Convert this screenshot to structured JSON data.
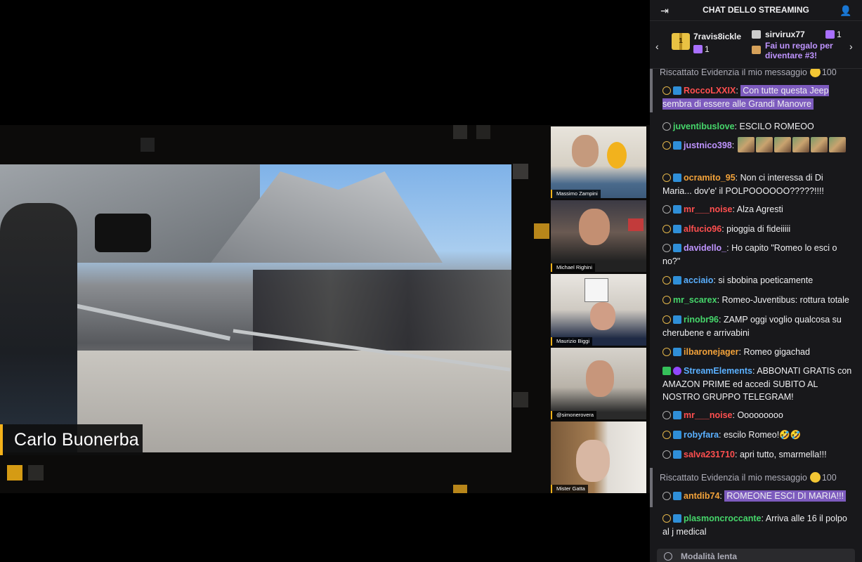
{
  "video": {
    "speaker_name": "Carlo Buonerba",
    "cams": [
      {
        "label": "Massimo Zampini"
      },
      {
        "label": "Michael Righini"
      },
      {
        "label": "Maurizio Biggi"
      },
      {
        "label": "@simonerovera"
      },
      {
        "label": "Mister Gatta"
      }
    ]
  },
  "chat": {
    "header": {
      "title": "CHAT DELLO STREAMING",
      "collapse_icon": "arrow-to-right-icon",
      "users_icon": "users-icon"
    },
    "gifts": {
      "top": {
        "badge": "1",
        "user": "7ravis8ickle",
        "count": "1"
      },
      "second": {
        "user": "sirvirux77",
        "count": "1"
      },
      "cta": "Fai un regalo per diventare #3!"
    },
    "redeem_label": "Riscattato Evidenzia il mio messaggio",
    "redeem_cost": "100",
    "messages": [
      {
        "user": "RoccoLXXIX",
        "color": "#ff4f4f",
        "text": "Con tutte questa Jeep sembra di essere alle Grandi Manovre"
      },
      {
        "user": "juventibuslove",
        "color": "#46d66b",
        "text": "ESCILO ROMEOO"
      },
      {
        "user": "justnico398",
        "color": "#bf94ff",
        "text": ""
      },
      {
        "user": "ocramito_95",
        "color": "#f2a23a",
        "text": "Non ci interessa di Di Maria... dov'e' il POLPOOOOOO?????!!!!"
      },
      {
        "user": "mr___noise",
        "color": "#ff4f4f",
        "text": "Alza Agresti"
      },
      {
        "user": "alfucio96",
        "color": "#ff4f4f",
        "text": "pioggia di fideiiiii"
      },
      {
        "user": "davidello_",
        "color": "#bf94ff",
        "text": "Ho capito \"Romeo lo esci o no?\""
      },
      {
        "user": "acciaio",
        "color": "#5ab0ff",
        "text": "si sbobina poeticamente"
      },
      {
        "user": "mr_scarex",
        "color": "#46d66b",
        "text": "Romeo-Juventibus: rottura totale"
      },
      {
        "user": "rinobr96",
        "color": "#46d66b",
        "text": "ZAMP oggi voglio qualcosa su cherubene e arrivabini"
      },
      {
        "user": "ilbaronejager",
        "color": "#f2a23a",
        "text": "Romeo gigachad"
      },
      {
        "user": "StreamElements",
        "color": "#5ab0ff",
        "text": "ABBONATI GRATIS con AMAZON PRIME ed accedi SUBITO AL NOSTRO GRUPPO TELEGRAM!"
      },
      {
        "user": "mr___noise",
        "color": "#ff4f4f",
        "text": "Ooooooooo"
      },
      {
        "user": "robyfara",
        "color": "#5ab0ff",
        "text": "escilo Romeo!🤣🤣"
      },
      {
        "user": "salva231710",
        "color": "#ff4f4f",
        "text": "apri tutto, smarmella!!!"
      },
      {
        "user": "antdib74",
        "color": "#f2a23a",
        "text": "ROMEONE ESCI DI MARIA!!!"
      },
      {
        "user": "plasmoncroccante",
        "color": "#46d66b",
        "text": "Arriva alle 16 il polpo al j medical"
      }
    ],
    "slow_mode": "Modalità lenta"
  }
}
